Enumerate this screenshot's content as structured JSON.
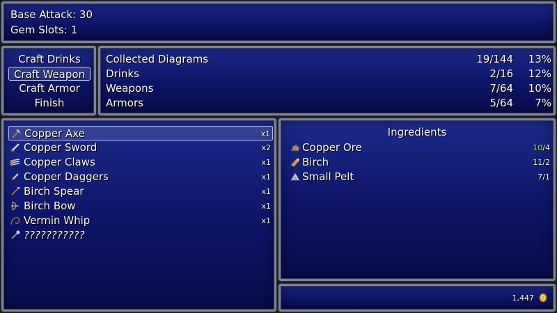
{
  "stats": {
    "base_attack": "Base Attack: 30",
    "gem_slots": "Gem Slots: 1"
  },
  "commands": [
    {
      "label": "Craft Drinks",
      "selected": false
    },
    {
      "label": "Craft Weapon",
      "selected": true
    },
    {
      "label": "Craft Armor",
      "selected": false
    },
    {
      "label": "Finish",
      "selected": false
    }
  ],
  "progress": [
    {
      "label": "Collected Diagrams",
      "count": "19/144",
      "percent": "13%"
    },
    {
      "label": "Drinks",
      "count": "2/16",
      "percent": "12%"
    },
    {
      "label": "Weapons",
      "count": "7/64",
      "percent": "10%"
    },
    {
      "label": "Armors",
      "count": "5/64",
      "percent": "7%"
    }
  ],
  "items": [
    {
      "name": "Copper Axe",
      "qty": "x1",
      "icon": "axe-icon",
      "selected": true
    },
    {
      "name": "Copper Sword",
      "qty": "x2",
      "icon": "sword-icon",
      "selected": false
    },
    {
      "name": "Copper Claws",
      "qty": "x1",
      "icon": "claws-icon",
      "selected": false
    },
    {
      "name": "Copper Daggers",
      "qty": "x1",
      "icon": "dagger-icon",
      "selected": false
    },
    {
      "name": "Birch Spear",
      "qty": "x1",
      "icon": "spear-icon",
      "selected": false
    },
    {
      "name": "Birch Bow",
      "qty": "x1",
      "icon": "bow-icon",
      "selected": false
    },
    {
      "name": "Vermin Whip",
      "qty": "x1",
      "icon": "whip-icon",
      "selected": false
    },
    {
      "name": "???????????",
      "qty": "",
      "icon": "unknown-weapon-icon",
      "selected": false
    }
  ],
  "ingredients": {
    "title": "Ingredients",
    "list": [
      {
        "name": "Copper Ore",
        "have": "10",
        "need": "/4",
        "icon": "ore-icon",
        "enough_color": "#80ff80"
      },
      {
        "name": "Birch",
        "have": "11",
        "need": "/2",
        "icon": "wood-log-icon",
        "enough_color": "#ffffff"
      },
      {
        "name": "Small Pelt",
        "have": "7",
        "need": "/1",
        "icon": "pelt-icon",
        "enough_color": "#ffffff"
      }
    ]
  },
  "gold": {
    "amount": "1,447",
    "icon": "gold-coin-icon"
  }
}
